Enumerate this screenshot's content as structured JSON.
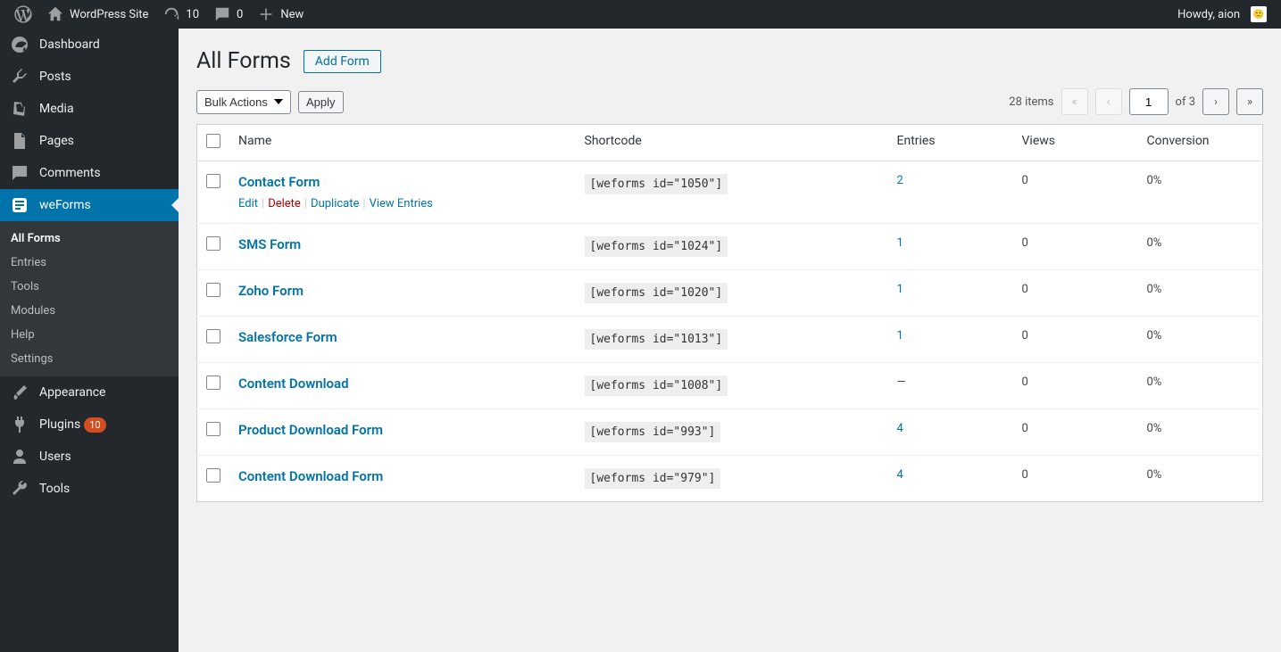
{
  "adminbar": {
    "site_name": "WordPress Site",
    "updates": "10",
    "comments": "0",
    "new": "New",
    "howdy": "Howdy, aion"
  },
  "sidebar": {
    "items": [
      {
        "label": "Dashboard",
        "icon": "dashboard"
      },
      {
        "label": "Posts",
        "icon": "pin"
      },
      {
        "label": "Media",
        "icon": "media"
      },
      {
        "label": "Pages",
        "icon": "page"
      },
      {
        "label": "Comments",
        "icon": "comment"
      },
      {
        "label": "weForms",
        "icon": "weforms",
        "active": true
      },
      {
        "label": "Appearance",
        "icon": "brush"
      },
      {
        "label": "Plugins",
        "icon": "plug",
        "badge": "10"
      },
      {
        "label": "Users",
        "icon": "user"
      },
      {
        "label": "Tools",
        "icon": "wrench"
      }
    ],
    "submenu": [
      {
        "label": "All Forms",
        "current": true
      },
      {
        "label": "Entries"
      },
      {
        "label": "Tools"
      },
      {
        "label": "Modules"
      },
      {
        "label": "Help"
      },
      {
        "label": "Settings"
      }
    ]
  },
  "page": {
    "title": "All Forms",
    "add": "Add Form",
    "bulk_action": "Bulk Actions",
    "apply": "Apply",
    "items": "28 items",
    "current_page": "1",
    "of": "of 3"
  },
  "columns": [
    "Name",
    "Shortcode",
    "Entries",
    "Views",
    "Conversion"
  ],
  "row_actions": [
    "Edit",
    "Delete",
    "Duplicate",
    "View Entries"
  ],
  "rows": [
    {
      "name": "Contact Form",
      "shortcode": "[weforms id=\"1050\"]",
      "entries": "2",
      "views": "0",
      "conv": "0%",
      "show_actions": true
    },
    {
      "name": "SMS Form",
      "shortcode": "[weforms id=\"1024\"]",
      "entries": "1",
      "views": "0",
      "conv": "0%"
    },
    {
      "name": "Zoho Form",
      "shortcode": "[weforms id=\"1020\"]",
      "entries": "1",
      "views": "0",
      "conv": "0%"
    },
    {
      "name": "Salesforce Form",
      "shortcode": "[weforms id=\"1013\"]",
      "entries": "1",
      "views": "0",
      "conv": "0%"
    },
    {
      "name": "Content Download",
      "shortcode": "[weforms id=\"1008\"]",
      "entries": "—",
      "views": "0",
      "conv": "0%",
      "entries_dash": true
    },
    {
      "name": "Product Download Form",
      "shortcode": "[weforms id=\"993\"]",
      "entries": "4",
      "views": "0",
      "conv": "0%"
    },
    {
      "name": "Content Download Form",
      "shortcode": "[weforms id=\"979\"]",
      "entries": "4",
      "views": "0",
      "conv": "0%"
    }
  ]
}
